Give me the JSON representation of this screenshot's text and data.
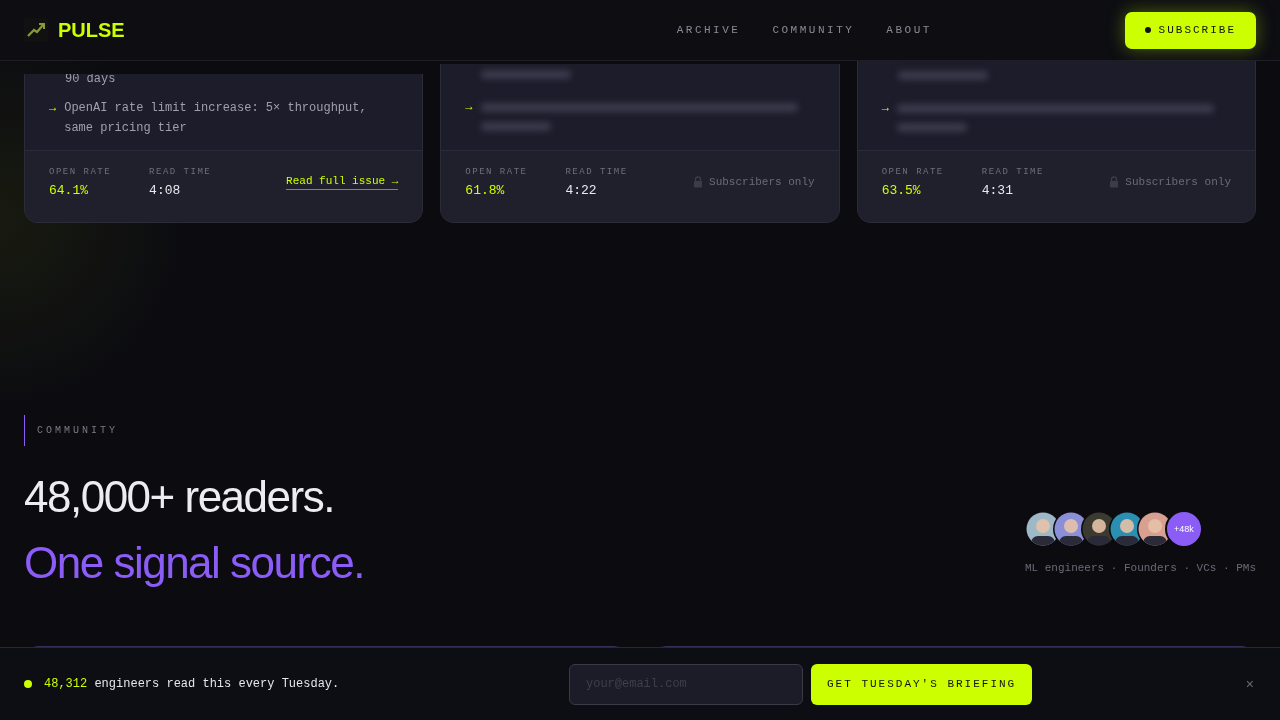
{
  "header": {
    "brand": "PULSE",
    "nav": [
      {
        "label": "ARCHIVE"
      },
      {
        "label": "COMMUNITY"
      },
      {
        "label": "ABOUT"
      }
    ],
    "subscribe": "SUBSCRIBE"
  },
  "issues": [
    {
      "locked": false,
      "marker": "→",
      "lead_line": "90 days",
      "bullets": [
        "OpenAI rate limit increase: 5× throughput, same pricing tier"
      ],
      "stats": [
        {
          "label": "OPEN RATE",
          "value": "64.1%"
        },
        {
          "label": "READ TIME",
          "value": "4:08"
        }
      ],
      "action": "Read full issue →"
    },
    {
      "locked": true,
      "marker": "→",
      "stats": [
        {
          "label": "OPEN RATE",
          "value": "61.8%"
        },
        {
          "label": "READ TIME",
          "value": "4:22"
        }
      ],
      "action": "Subscribers only"
    },
    {
      "locked": true,
      "marker": "→",
      "stats": [
        {
          "label": "OPEN RATE",
          "value": "63.5%"
        },
        {
          "label": "READ TIME",
          "value": "4:31"
        }
      ],
      "action": "Subscribers only"
    }
  ],
  "community": {
    "eyebrow": "COMMUNITY",
    "title": "48,000+ readers.",
    "subtitle": "One signal source.",
    "more": "+48k",
    "audience": "ML engineers · Founders · VCs · PMs"
  },
  "signup_bar": {
    "count": "48,312",
    "text": "engineers read this every Tuesday.",
    "placeholder": "your@email.com",
    "button": "GET TUESDAY'S BRIEFING",
    "close": "×"
  }
}
